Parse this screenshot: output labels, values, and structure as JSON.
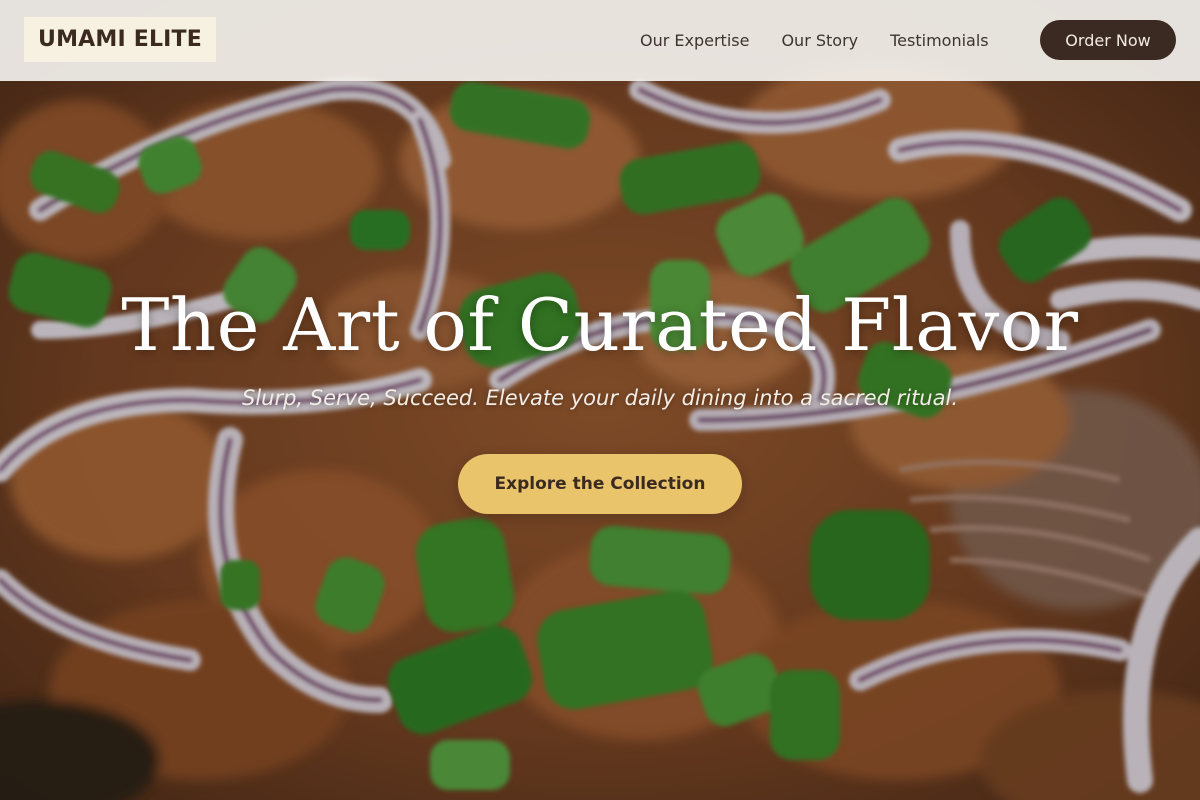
{
  "brand": {
    "logo_text": "UMAMI ELITE"
  },
  "nav": {
    "links": [
      {
        "label": "Our Expertise"
      },
      {
        "label": "Our Story"
      },
      {
        "label": "Testimonials"
      }
    ],
    "order_label": "Order Now"
  },
  "hero": {
    "title": "The Art of Curated Flavor",
    "subtitle": "Slurp, Serve, Succeed. Elevate your daily dining into a sacred ritual.",
    "cta_label": "Explore the Collection",
    "background_image": "food-dish-photo"
  },
  "colors": {
    "nav_background": "#f2f0ec",
    "logo_background": "#f6f1e1",
    "order_button": "#3b2a22",
    "cta_button": "#e9c46b",
    "text_dark": "#3a2a20"
  }
}
